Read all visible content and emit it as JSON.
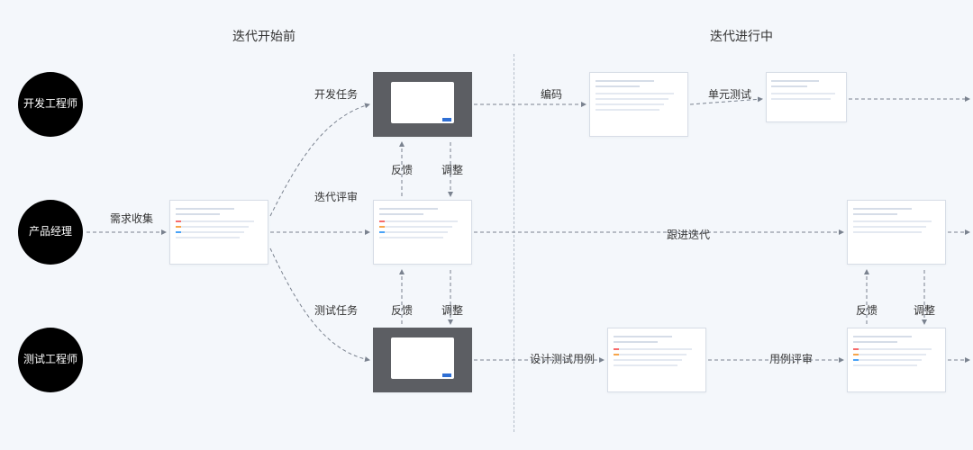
{
  "phases": {
    "before": "迭代开始前",
    "during": "迭代进行中"
  },
  "roles": {
    "dev": "开发工程师",
    "pm": "产品经理",
    "qa": "测试工程师"
  },
  "labels": {
    "req_collect": "需求收集",
    "dev_task": "开发任务",
    "qa_task": "测试任务",
    "iter_review": "迭代评审",
    "feedback": "反馈",
    "adjust": "调整",
    "coding": "编码",
    "unit_test": "单元测试",
    "follow_iter": "跟进迭代",
    "design_case": "设计测试用例",
    "case_review": "用例评审",
    "feedback2": "反馈",
    "adjust2": "调整"
  }
}
